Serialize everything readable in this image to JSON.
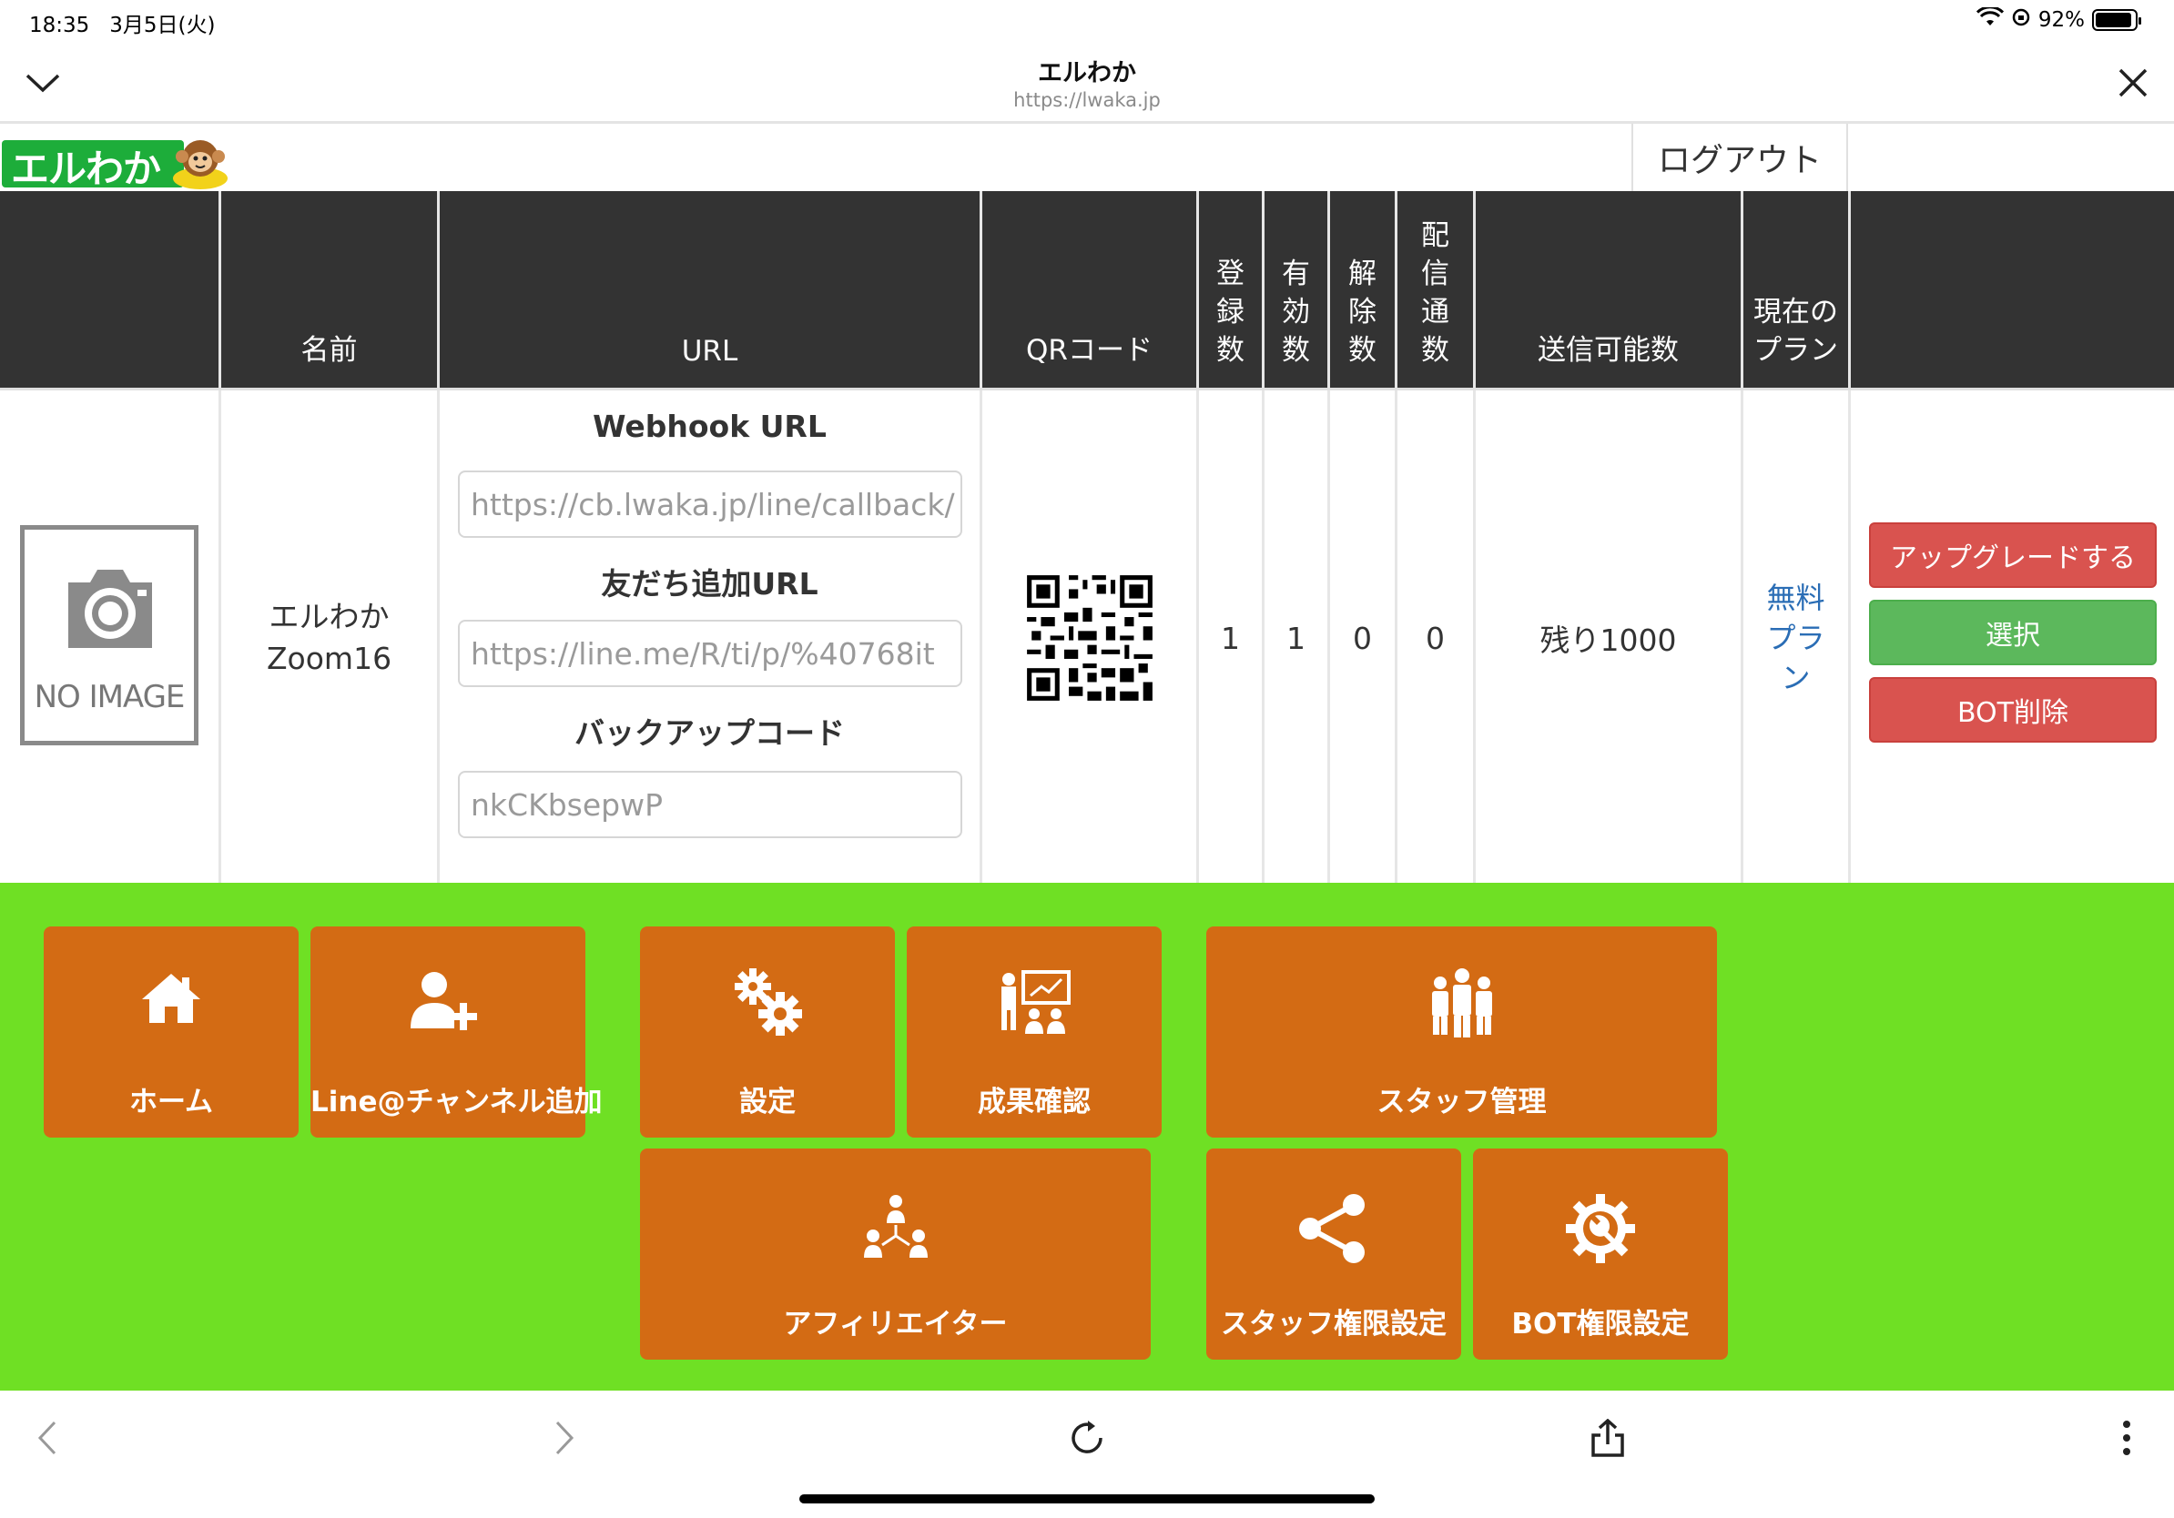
{
  "status_bar": {
    "time": "18:35",
    "date": "3月5日(火)",
    "battery": "92%",
    "battery_level": 0.92
  },
  "browser": {
    "title": "エルわか",
    "url": "https://lwaka.jp"
  },
  "app": {
    "logo_text": "エルわか",
    "logout_label": "ログアウト"
  },
  "table": {
    "headers": {
      "image": "",
      "name": "名前",
      "url": "URL",
      "qr": "QRコード",
      "registered": "登録数",
      "active": "有効数",
      "cancelled": "解除数",
      "delivery": "配信通数",
      "sendable": "送信可能数",
      "plan": "現在のプラン",
      "actions": ""
    },
    "row": {
      "no_image": "NO IMAGE",
      "name_line1": "エルわか",
      "name_line2": "Zoom16",
      "webhook_title": "Webhook URL",
      "webhook_value": "https://cb.lwaka.jp/line/callback/",
      "friend_title": "友だち追加URL",
      "friend_value": "https://line.me/R/ti/p/%40768it",
      "backup_title": "バックアップコード",
      "backup_value": "nkCKbsepwP",
      "registered": "1",
      "active": "1",
      "cancelled": "0",
      "delivery": "0",
      "sendable": "残り1000",
      "plan": "無料プラン",
      "upgrade_label": "アップグレードする",
      "select_label": "選択",
      "delete_label": "BOT削除"
    }
  },
  "menu": {
    "home": "ホーム",
    "add_channel": "Line@チャンネル追加",
    "settings": "設定",
    "results": "成果確認",
    "staff": "スタッフ管理",
    "affiliate": "アフィリエイター",
    "staff_permissions": "スタッフ権限設定",
    "bot_permissions": "BOT権限設定"
  },
  "colors": {
    "header_bg": "#333333",
    "menu_bg": "#6fe024",
    "tile_bg": "#d36b14",
    "btn_red": "#d9534f",
    "btn_green": "#5cb85c",
    "link_blue": "#2a6db5",
    "logo_green": "#1dad3a"
  }
}
